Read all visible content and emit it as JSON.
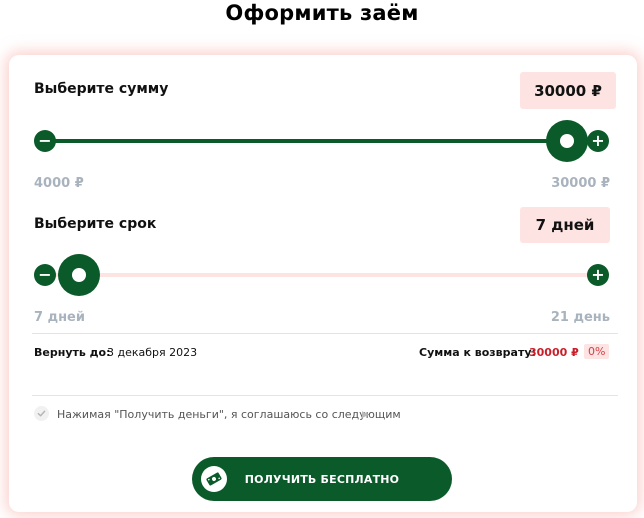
{
  "page": {
    "title": "Оформить заём"
  },
  "amount": {
    "label": "Выберите сумму",
    "value_display": "30000 ₽",
    "value": 30000,
    "min_label": "4000 ₽",
    "max_label": "30000 ₽",
    "min": 4000,
    "max": 30000,
    "fraction": 1.0,
    "minus_symbol": "−",
    "plus_symbol": "+"
  },
  "term": {
    "label": "Выберите срок",
    "value_display": "7 дней",
    "value": 7,
    "min_label": "7 дней",
    "max_label": "21 день",
    "min": 7,
    "max": 21,
    "fraction": 0.0,
    "minus_symbol": "−",
    "plus_symbol": "+"
  },
  "summary": {
    "return_label": "Вернуть до:",
    "return_date": "3 декабря 2023",
    "total_label": "Сумма к возврату:",
    "total_value": "30000 ₽",
    "percent": "0%"
  },
  "consent": {
    "text": "Нажимая \"Получить деньги\", я соглашаюсь со следующим",
    "expand_symbol": "▶"
  },
  "cta": {
    "label": "ПОЛУЧИТЬ БЕСПЛАТНО"
  },
  "colors": {
    "accent": "#0b5a2a",
    "accent_soft": "#fde3e2",
    "amount_red": "#c8202a",
    "muted": "#a9b3be"
  }
}
